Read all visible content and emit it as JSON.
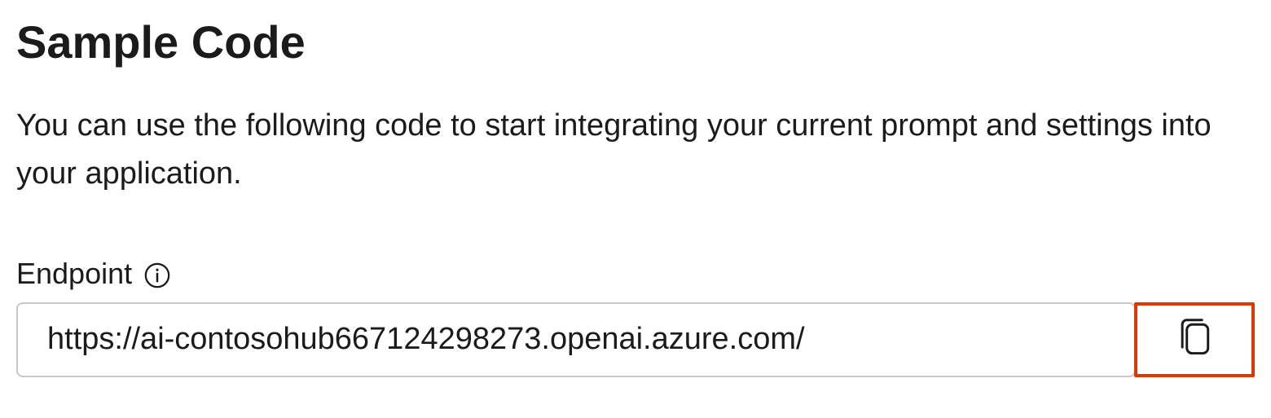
{
  "header": {
    "title": "Sample Code"
  },
  "description": "You can use the following code to start integrating your current prompt and settings into your application.",
  "endpoint": {
    "label": "Endpoint",
    "value": "https://ai-contosohub667124298273.openai.azure.com/",
    "highlight_color": "#d83b01"
  },
  "icons": {
    "info": "info-icon",
    "copy": "copy-icon"
  }
}
